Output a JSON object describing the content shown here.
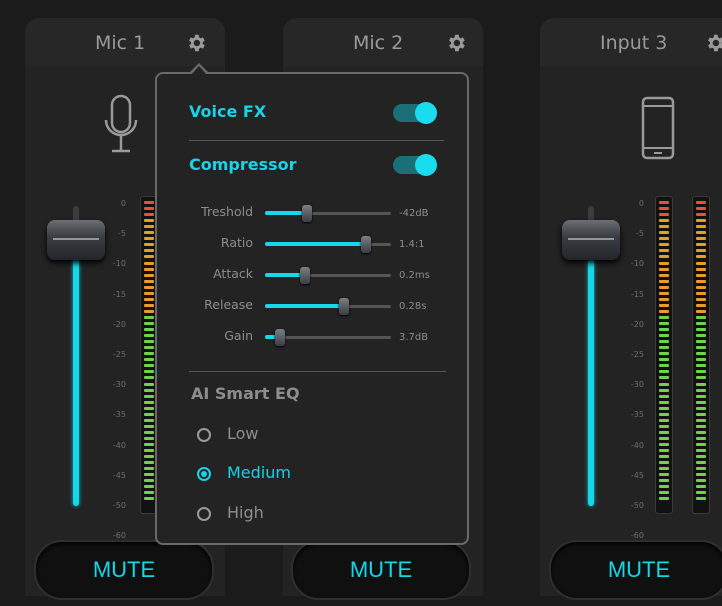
{
  "channels": [
    {
      "label": "Mic 1",
      "device_icon": "microphone-icon",
      "fader_level": 0.0,
      "mute_label": "MUTE"
    },
    {
      "label": "Mic 2",
      "device_icon": "",
      "fader_level": 0.0,
      "mute_label": "MUTE"
    },
    {
      "label": "Input 3",
      "device_icon": "phone-icon",
      "fader_level": 0.0,
      "mute_label": "MUTE"
    }
  ],
  "meter_scale": [
    "0",
    "-5",
    "-10",
    "-15",
    "-20",
    "-25",
    "-30",
    "-35",
    "-40",
    "-45",
    "-50",
    "-60"
  ],
  "colors": {
    "accent": "#19d3e6",
    "meter_red": "#e0572a",
    "meter_orange": "#e69c25",
    "meter_green": "#6fd24a"
  },
  "popup": {
    "voice_fx": {
      "label": "Voice FX",
      "enabled": true
    },
    "compressor": {
      "label": "Compressor",
      "enabled": true
    },
    "sliders": [
      {
        "label": "Treshold",
        "value": "-42dB",
        "level": 0.33
      },
      {
        "label": "Ratio",
        "value": "1.4:1",
        "level": 0.8
      },
      {
        "label": "Attack",
        "value": "0.2ms",
        "level": 0.32
      },
      {
        "label": "Release",
        "value": "0.28s",
        "level": 0.63
      },
      {
        "label": "Gain",
        "value": "3.7dB",
        "level": 0.12
      }
    ],
    "eq": {
      "title": "AI Smart EQ",
      "options": [
        "Low",
        "Medium",
        "High"
      ],
      "selected": "Medium"
    }
  }
}
